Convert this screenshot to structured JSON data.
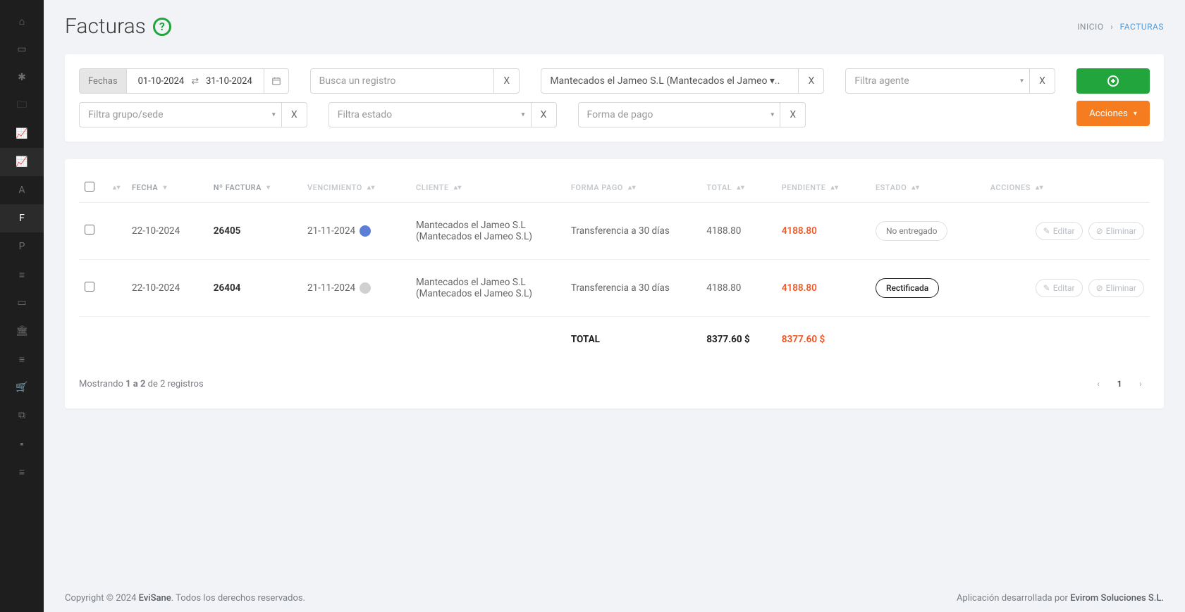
{
  "page": {
    "title": "Facturas"
  },
  "breadcrumb": {
    "home": "INICIO",
    "current": "FACTURAS"
  },
  "filters": {
    "date_label": "Fechas",
    "date_from": "01-10-2024",
    "date_to": "31-10-2024",
    "search_placeholder": "Busca un registro",
    "client_value": "Mantecados el Jameo S.L (Mantecados el Jameo ▾..",
    "agent_placeholder": "Filtra agente",
    "group_placeholder": "Filtra grupo/sede",
    "state_placeholder": "Filtra estado",
    "payment_placeholder": "Forma de pago",
    "actions_label": "Acciones"
  },
  "table": {
    "headers": {
      "fecha": "FECHA",
      "nfactura": "Nº FACTURA",
      "venc": "VENCIMIENTO",
      "cliente": "CLIENTE",
      "forma": "FORMA PAGO",
      "total": "TOTAL",
      "pend": "PENDIENTE",
      "estado": "ESTADO",
      "acc": "ACCIONES"
    },
    "rows": [
      {
        "fecha": "22-10-2024",
        "num": "26405",
        "venc": "21-11-2024",
        "venc_color": "blue",
        "cliente": "Mantecados el Jameo S.L (Mantecados el Jameo S.L)",
        "forma": "Transferencia a 30 días",
        "total": "4188.80",
        "pend": "4188.80",
        "estado": "No entregado",
        "estado_kind": "nd"
      },
      {
        "fecha": "22-10-2024",
        "num": "26404",
        "venc": "21-11-2024",
        "venc_color": "grey",
        "cliente": "Mantecados el Jameo S.L (Mantecados el Jameo S.L)",
        "forma": "Transferencia a 30 días",
        "total": "4188.80",
        "pend": "4188.80",
        "estado": "Rectificada",
        "estado_kind": "rect"
      }
    ],
    "totals": {
      "label": "TOTAL",
      "total": "8377.60 $",
      "pend": "8377.60 $"
    },
    "actions": {
      "edit": "Editar",
      "delete": "Eliminar"
    },
    "showing_prefix": "Mostrando ",
    "showing_range": "1 a 2",
    "showing_suffix": " de 2 registros",
    "page_current": "1"
  },
  "footer": {
    "copyright_pre": "Copyright © 2024 ",
    "brand": "EviSane",
    "copyright_post": ". Todos los derechos reservados.",
    "dev_pre": "Aplicación desarrollada por ",
    "dev_link": "Evirom Soluciones S.L."
  },
  "sidebar_letters": {
    "a": "A",
    "f": "F",
    "p": "P"
  }
}
